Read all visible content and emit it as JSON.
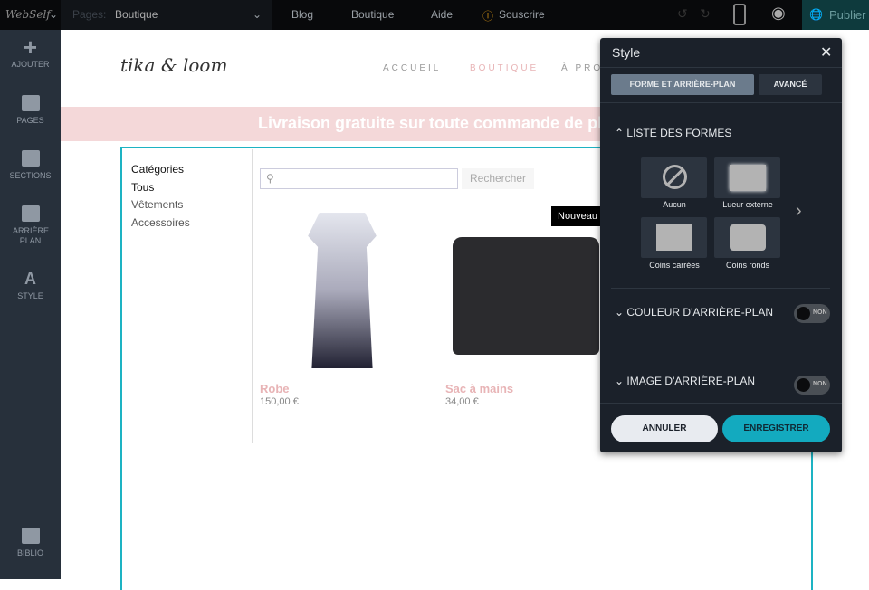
{
  "topbar": {
    "logo": "WebSelf",
    "pages_label": "Pages:",
    "pages_value": "Boutique",
    "links": [
      "Blog",
      "Boutique",
      "Aide"
    ],
    "subscribe": "Souscrire",
    "publish": "Publier"
  },
  "sidebar": {
    "items": [
      "AJOUTER",
      "PAGES",
      "SECTIONS",
      "ARRIÈRE PLAN",
      "STYLE"
    ],
    "bottom": "BIBLIO"
  },
  "site": {
    "logo": "tika & loom",
    "nav": [
      "ACCUEIL",
      "BOUTIQUE",
      "À PRO"
    ],
    "banner": "Livraison gratuite sur toute commande de pl",
    "categories_title": "Catégories",
    "categories": [
      "Tous",
      "Vêtements",
      "Accessoires"
    ],
    "search_placeholder": "",
    "search_button": "Rechercher",
    "badge": "Nouveau",
    "products": [
      {
        "name": "Robe",
        "price": "150,00 €"
      },
      {
        "name": "Sac à mains",
        "price": "34,00 €"
      }
    ]
  },
  "panel": {
    "title": "Style",
    "tabs": [
      "FORME ET ARRIÈRE-PLAN",
      "AVANCÉ"
    ],
    "shapes_title": "LISTE DES FORMES",
    "shapes": [
      "Aucun",
      "Lueur externe",
      "Coins carrées",
      "Coins ronds"
    ],
    "bg_color": "COULEUR D'ARRIÈRE-PLAN",
    "bg_image": "IMAGE D'ARRIÈRE-PLAN",
    "toggle_off": "NON",
    "cancel": "ANNULER",
    "save": "ENREGISTRER"
  },
  "colors": {
    "accent": "#1db3c3",
    "pink": "#e8b4b6",
    "panel": "#1b212a"
  }
}
